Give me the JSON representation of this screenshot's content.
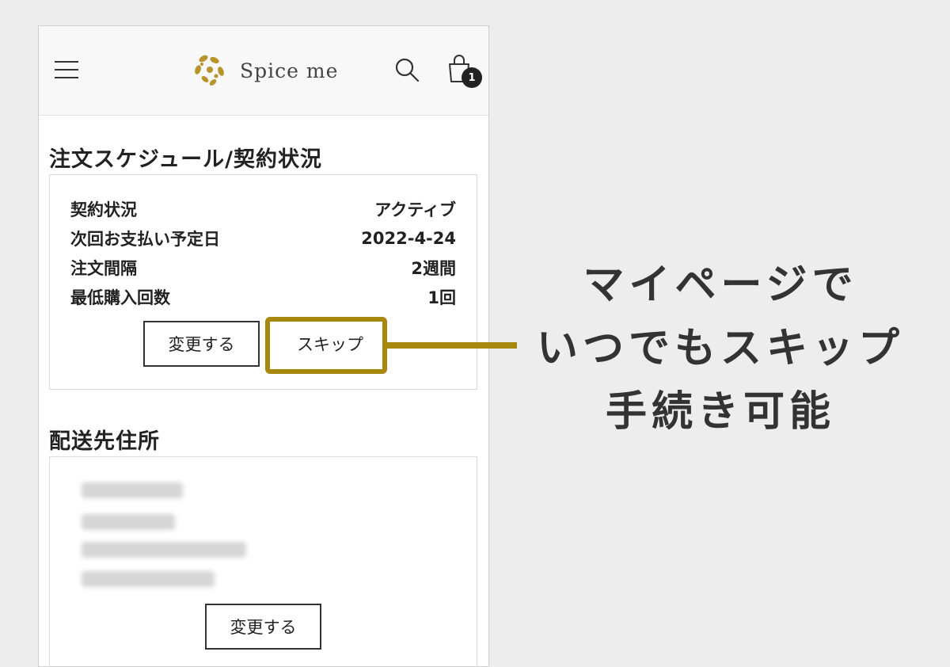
{
  "header": {
    "brand_name": "Spice me",
    "cart_count": "1"
  },
  "schedule": {
    "title": "注文スケジュール/契約状況",
    "rows": [
      {
        "label": "契約状況",
        "value": "アクティブ"
      },
      {
        "label": "次回お支払い予定日",
        "value": "2022-4-24"
      },
      {
        "label": "注文間隔",
        "value": "2週間"
      },
      {
        "label": "最低購入回数",
        "value": "1回"
      }
    ],
    "change_label": "変更する",
    "skip_label": "スキップ"
  },
  "shipping": {
    "title": "配送先住所",
    "change_label": "変更する"
  },
  "annotation": {
    "lines": [
      "マイページで",
      "いつでもスキップ",
      "手続き可能"
    ]
  },
  "colors": {
    "accent": "#a7880e",
    "background": "#ededed"
  }
}
